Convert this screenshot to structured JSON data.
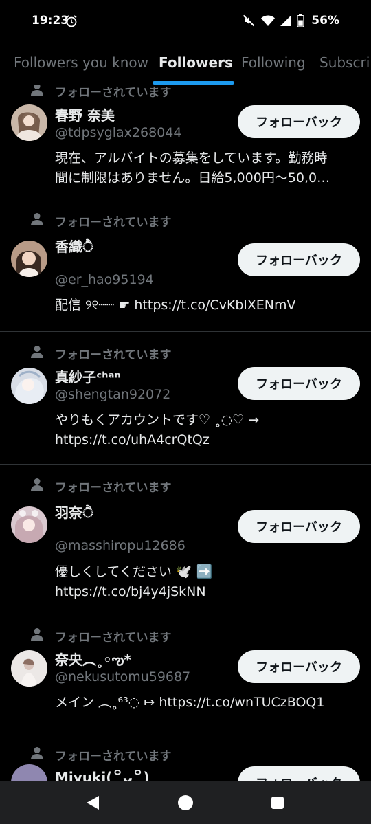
{
  "status_bar": {
    "time": "19:23",
    "battery": "56%",
    "icons": [
      "alarm-icon",
      "mute-icon",
      "wifi-icon",
      "signal-icon",
      "battery-icon"
    ]
  },
  "tabs": [
    {
      "label": "Followers you know",
      "active": false
    },
    {
      "label": "Followers",
      "active": true
    },
    {
      "label": "Following",
      "active": false
    },
    {
      "label": "Subscri",
      "active": false
    }
  ],
  "colors": {
    "accent": "#1d9bf0",
    "background": "#000000",
    "text_primary": "#e7e9ea",
    "text_secondary": "#71767b",
    "button_bg": "#eff3f4",
    "button_text": "#0f1419"
  },
  "followers": [
    {
      "followed_label": "フォローされています",
      "name": "春野 奈美",
      "handle": "@tdpsyglax268044",
      "bio": "現在、アルバイトの募集をしています。勤務時\n間に制限はありません。日給5,000円〜50,0…",
      "button": "フォローバック",
      "avatar_color": "#c9b7a8"
    },
    {
      "followed_label": "フォローされています",
      "name": "香織ੈ",
      "handle": "@er_hao95194",
      "bio": "配信 ୨୧┈┈ ☛ https://t.co/CvKblXENmV",
      "button": "フォローバック",
      "avatar_color": "#b89b87"
    },
    {
      "followed_label": "フォローされています",
      "name": "真紗子ᶜʰᵃⁿ",
      "handle": "@shengtan92072",
      "bio": "やりもくアカウントです♡ ˳◌♡ →\nhttps://t.co/uhA4crQtQz",
      "button": "フォローバック",
      "avatar_color": "#d8dde6"
    },
    {
      "followed_label": "フォローされています",
      "name": "羽奈ੈ",
      "handle": "@masshiropu12686",
      "bio": "優しくしてください 🕊️ ➡️\nhttps://t.co/bj4y4jSkNN",
      "button": "フォローバック",
      "avatar_color": "#d9c8cf"
    },
    {
      "followed_label": "フォローされています",
      "name": "奈央︵˳◦ఌ*",
      "handle": "@nekusutomu59687",
      "bio": "メイン ︵˳⁶³◌ ↦ https://t.co/wnTUCzBOQ1",
      "button": "フォローバック",
      "avatar_color": "#ece8e6"
    },
    {
      "followed_label": "フォローされています",
      "name": "Miyuki(꒪ᴗ꒪)",
      "handle": "",
      "bio": "",
      "button": "フォローバック",
      "avatar_color": "#8f87b0"
    }
  ]
}
